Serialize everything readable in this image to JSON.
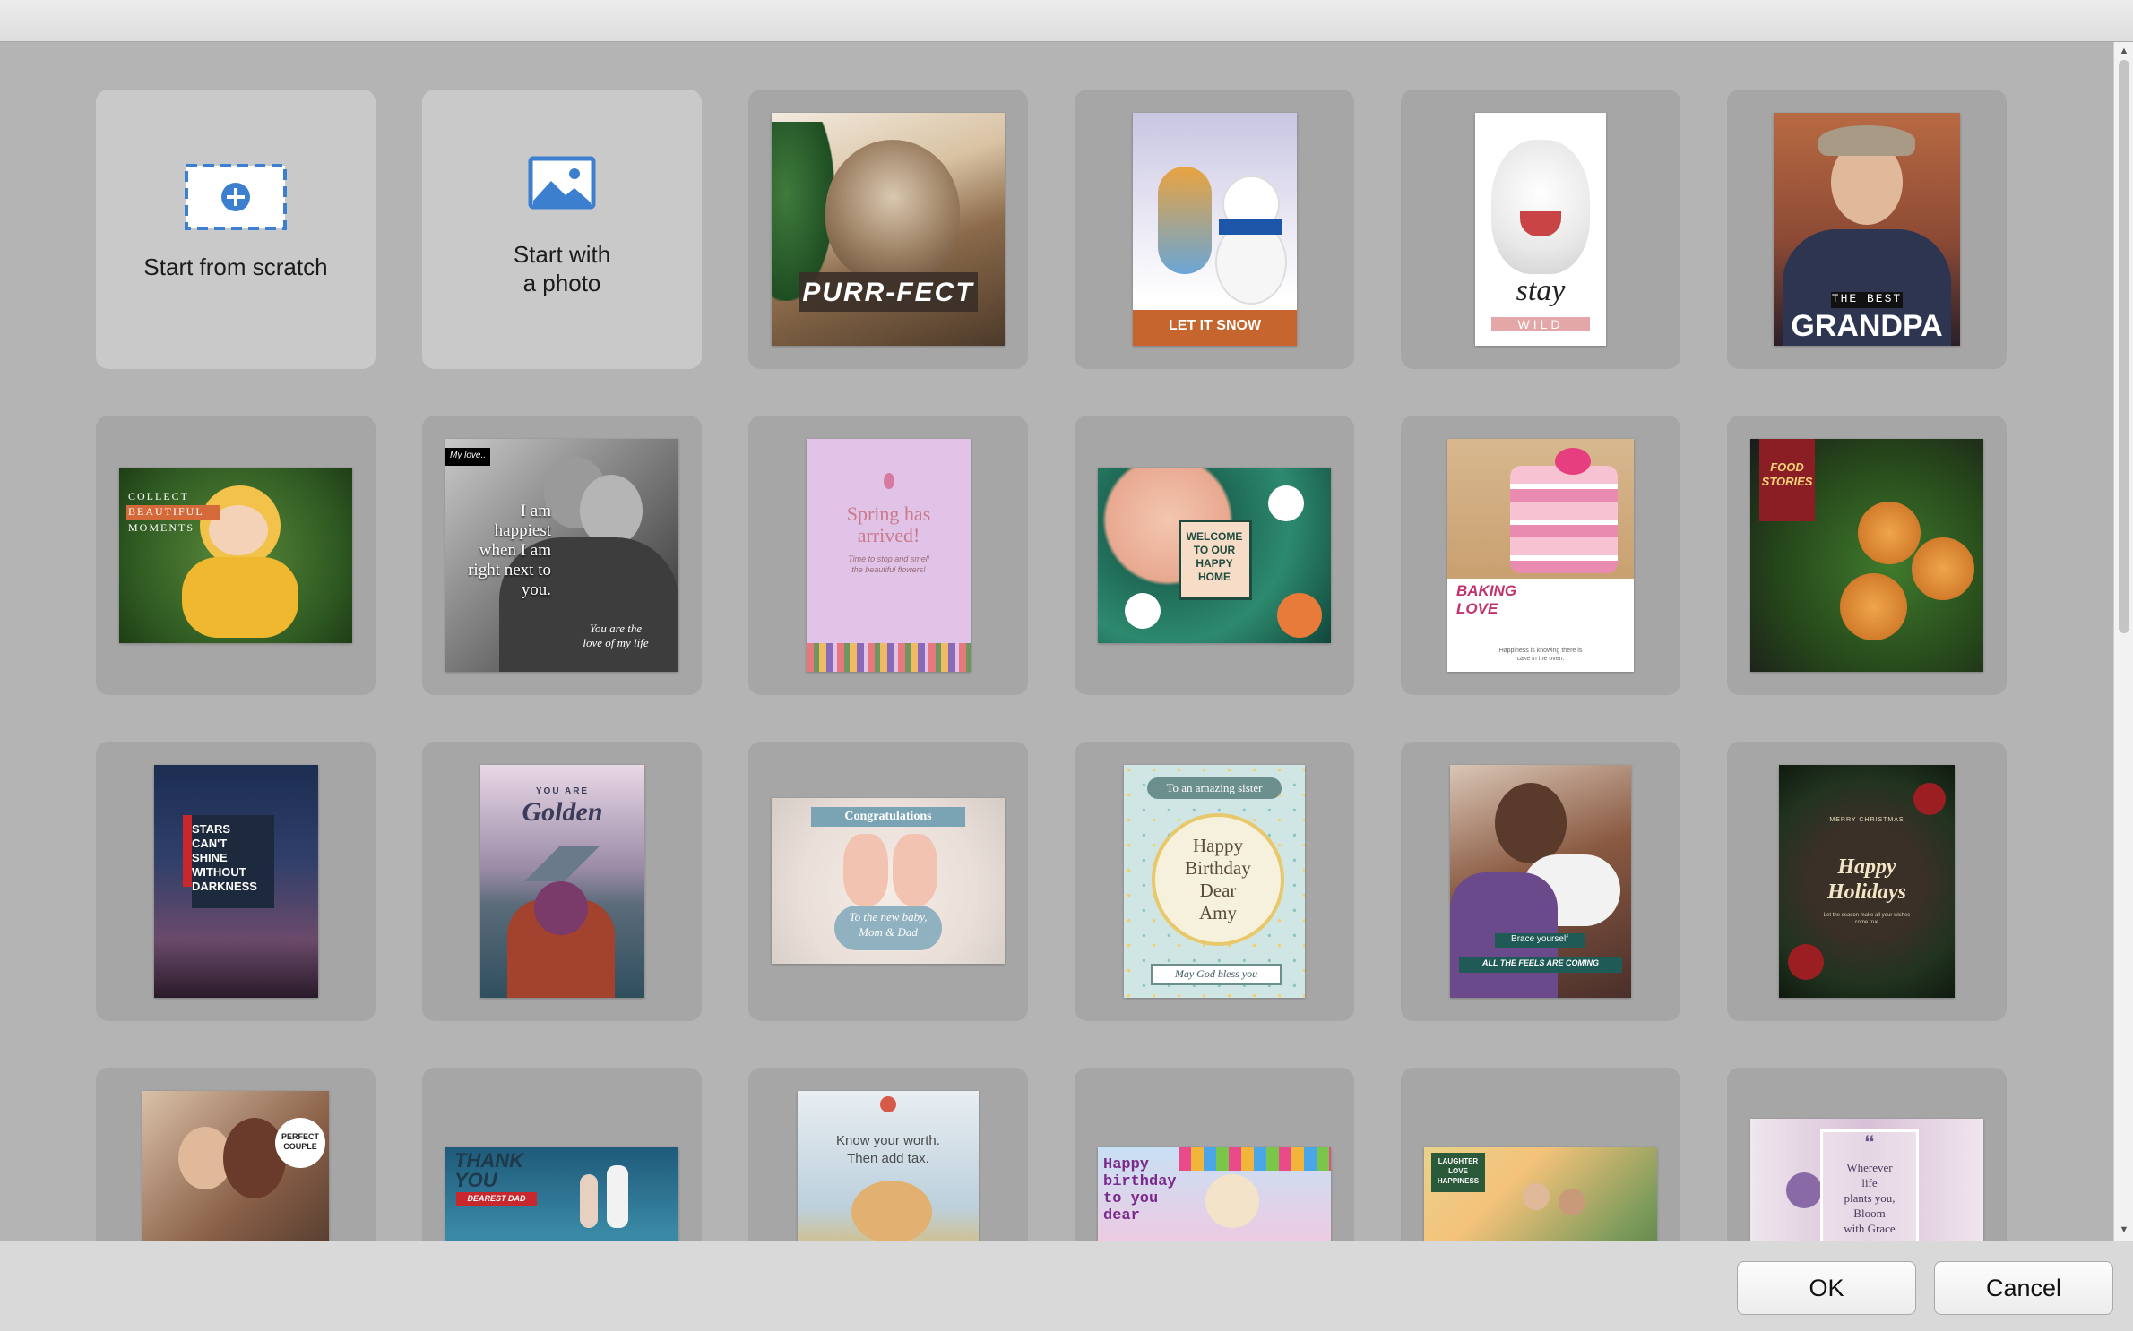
{
  "templates": {
    "scratch_label": "Start from scratch",
    "photo_label": "Start with\na photo",
    "items": [
      {
        "texts": [
          "PURR-FECT"
        ]
      },
      {
        "texts": [
          "LET IT SNOW"
        ]
      },
      {
        "texts": [
          "stay",
          "WILD"
        ]
      },
      {
        "texts": [
          "THE BEST",
          "GRANDPA"
        ]
      },
      {
        "texts": [
          "COLLECT",
          "BEAUTIFUL",
          "MOMENTS"
        ]
      },
      {
        "texts": [
          "My love..",
          "I am\nhappiest\nwhen I am\nright next to\nyou.",
          "You are the\nlove of my life"
        ]
      },
      {
        "texts": [
          "Spring has\narrived!",
          "Time to stop and smell\nthe beautiful flowers!"
        ]
      },
      {
        "texts": [
          "WELCOME\nTO OUR\nHAPPY\nHOME"
        ]
      },
      {
        "texts": [
          "BAKING\nLOVE",
          "Happiness is knowing there is\ncake in the oven."
        ]
      },
      {
        "texts": [
          "FOOD\nSTORIES"
        ]
      },
      {
        "texts": [
          "STARS\nCAN'T\nSHINE\nWITHOUT\nDARKNESS"
        ]
      },
      {
        "texts": [
          "YOU ARE",
          "Golden"
        ]
      },
      {
        "texts": [
          "Congratulations",
          "To the new baby,\nMom & Dad"
        ]
      },
      {
        "texts": [
          "To an amazing sister",
          "Happy\nBirthday\nDear\nAmy",
          "May God bless you"
        ]
      },
      {
        "texts": [
          "Brace yourself",
          "ALL THE FEELS ARE COMING"
        ]
      },
      {
        "texts": [
          "MERRY CHRISTMAS",
          "Happy\nHolidays",
          "Let the season make all your wishes\ncome true"
        ]
      },
      {
        "texts": [
          "PERFECT\nCOUPLE"
        ]
      },
      {
        "texts": [
          "THANK\nYOU",
          "DEAREST DAD"
        ]
      },
      {
        "texts": [
          "Know your worth.\nThen add tax."
        ]
      },
      {
        "texts": [
          "Happy\nbirthday\nto you\ndear"
        ]
      },
      {
        "texts": [
          "LAUGHTER\nLOVE\nHAPPINESS"
        ]
      },
      {
        "texts": [
          "“",
          "Wherever\nlife\nplants you,\nBloom\nwith Grace"
        ]
      }
    ]
  },
  "buttons": {
    "ok": "OK",
    "cancel": "Cancel"
  },
  "colors": {
    "content_bg": "#b4b4b4",
    "card_bg": "#a6a6a6",
    "action_card_bg": "#c9c9c9",
    "accent_icon": "#3d7fcf"
  }
}
